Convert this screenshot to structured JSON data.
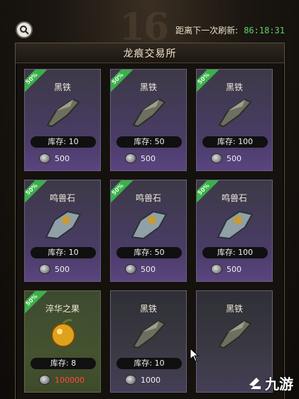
{
  "background_numeral": "16",
  "header": {
    "refresh_label": "距离下一次刷新:",
    "refresh_timer": "86:18:31"
  },
  "panel": {
    "title": "龙痕交易所"
  },
  "items": [
    {
      "name": "黑铁",
      "discount": "50%",
      "stock": "库存: 10",
      "price": "500",
      "art": "iron"
    },
    {
      "name": "黑铁",
      "discount": "50%",
      "stock": "库存: 50",
      "price": "500",
      "art": "iron"
    },
    {
      "name": "黑铁",
      "discount": "50%",
      "stock": "库存: 100",
      "price": "500",
      "art": "iron"
    },
    {
      "name": "鸣兽石",
      "discount": "50%",
      "stock": "库存: 10",
      "price": "500",
      "art": "stone"
    },
    {
      "name": "鸣兽石",
      "discount": "50%",
      "stock": "库存: 50",
      "price": "500",
      "art": "stone"
    },
    {
      "name": "鸣兽石",
      "discount": "50%",
      "stock": "库存: 100",
      "price": "500",
      "art": "stone"
    },
    {
      "name": "淬华之果",
      "discount": "50%",
      "stock": "库存: 8",
      "price": "100000",
      "art": "fruit"
    },
    {
      "name": "黑铁",
      "discount": "",
      "stock": "库存: 10",
      "price": "1000",
      "art": "iron"
    },
    {
      "name": "黑铁",
      "discount": "",
      "stock": "",
      "price": "",
      "art": "iron"
    }
  ],
  "watermark": "九游",
  "colors": {
    "timer": "#5fd26a",
    "ribbon": "#3bb04a",
    "price_insufficient": "#ff4a3a"
  }
}
